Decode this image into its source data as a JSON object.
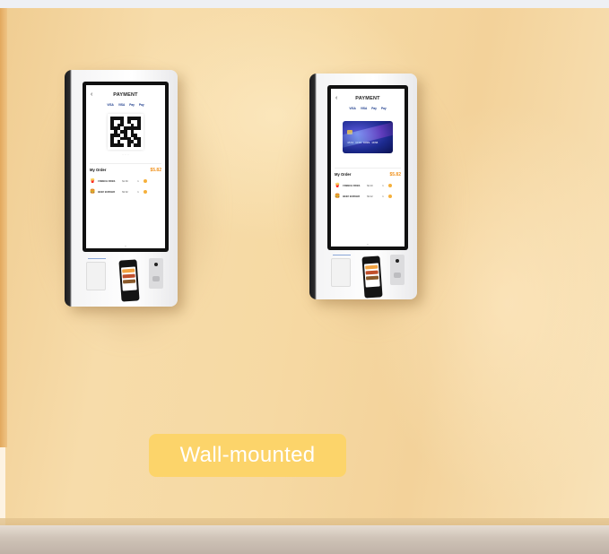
{
  "badge": {
    "label": "Wall-mounted"
  },
  "kiosks": [
    {
      "screen_title": "PAYMENT",
      "payment_methods": [
        "VISA",
        "VISA",
        "Pay",
        "Pay"
      ],
      "order_title": "My Order",
      "order_total": "$5.82",
      "items": [
        {
          "name": "FRENCH FRIES",
          "price": "$1.60",
          "qty": "1"
        },
        {
          "name": "BEEF BURGER",
          "price": "$3.62",
          "qty": "1"
        }
      ]
    },
    {
      "screen_title": "PAYMENT",
      "payment_methods": [
        "VISA",
        "VISA",
        "Pay",
        "Pay"
      ],
      "card_number": "4532 3190 8999 1038",
      "order_title": "My Order",
      "order_total": "$5.82",
      "items": [
        {
          "name": "FRENCH FRIES",
          "price": "$2.40",
          "qty": "1"
        },
        {
          "name": "BEEF BURGER",
          "price": "$3.42",
          "qty": "1"
        }
      ]
    }
  ],
  "icons": [
    "qr-code-icon",
    "fries-icon",
    "burger-icon",
    "credit-card-icon",
    "back-arrow-icon"
  ],
  "colors": {
    "badge": "#fcd46a",
    "wall": "#f6d9a3",
    "accent": "#f0921e"
  }
}
